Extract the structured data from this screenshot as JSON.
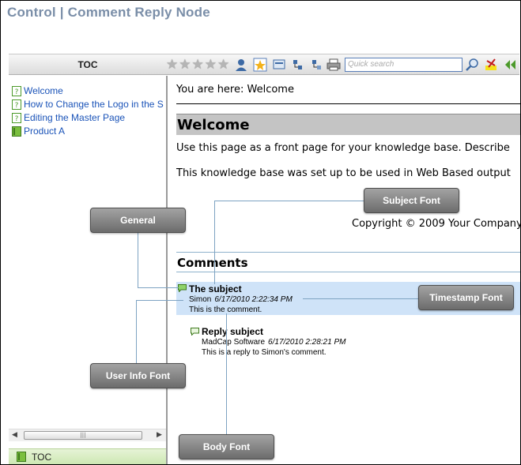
{
  "page_title": "Control | Comment Reply Node",
  "toolbar": {
    "toc_tab": "TOC",
    "rating_stars": 5,
    "search_placeholder": "Quick search"
  },
  "toc": {
    "items": [
      {
        "label": "Welcome",
        "icon": "topic-icon"
      },
      {
        "label": "How to Change the Logo in the S",
        "icon": "topic-icon"
      },
      {
        "label": "Editing the Master Page",
        "icon": "topic-icon"
      },
      {
        "label": "Product A",
        "icon": "book-icon"
      }
    ],
    "bottom_tab": "TOC"
  },
  "content": {
    "breadcrumb": "You are here: Welcome",
    "heading": "Welcome",
    "para1": "Use this page as a front page for your knowledge base. Describe",
    "para2": "This knowledge base was set up to be used in Web Based output",
    "copyright": "Copyright © 2009 Your Company",
    "comments_heading": "Comments",
    "comments": [
      {
        "subject": "The subject",
        "user": "Simon",
        "timestamp": "6/17/2010 2:22:34 PM",
        "body": "This is the comment.",
        "selected": true
      },
      {
        "subject": "Reply subject",
        "user": "MadCap Software",
        "timestamp": "6/17/2010 2:28:21 PM",
        "body": "This is a reply to Simon's comment.",
        "selected": false
      }
    ]
  },
  "callouts": {
    "general": "General",
    "subject_font": "Subject Font",
    "timestamp_font": "Timestamp Font",
    "user_info_font": "User Info Font",
    "body_font": "Body Font"
  },
  "colors": {
    "title": "#7a8ea8",
    "link": "#1a53b8",
    "selected_comment_bg": "#cfe3f8",
    "callout_bg": "#8a8a8a",
    "leader_line": "#7ea3c2"
  }
}
